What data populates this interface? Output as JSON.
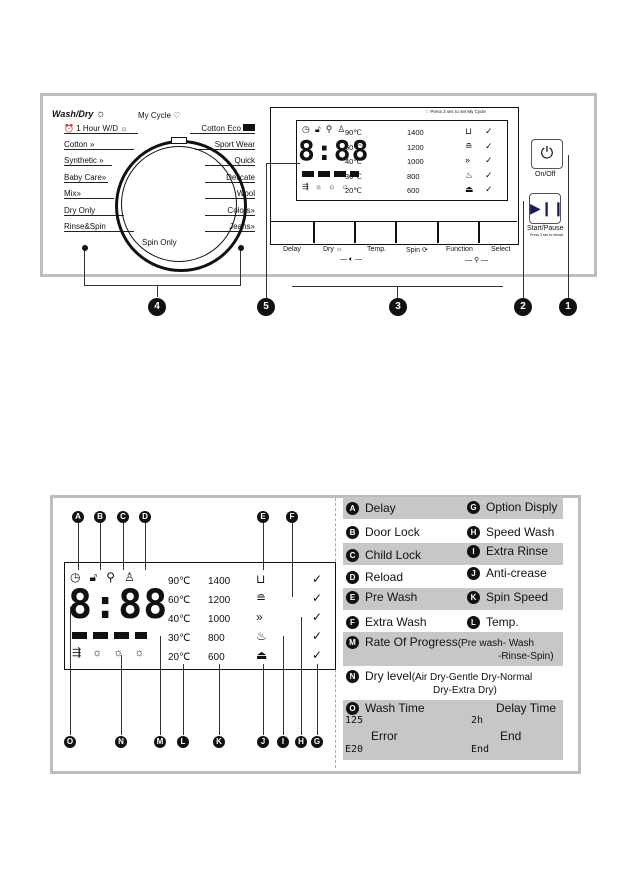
{
  "control_panel": {
    "brand": "Wash/Dry",
    "knob_top": "My Cycle",
    "knob_bottom": "Spin Only",
    "programs_left": [
      "1 Hour W/D",
      "Cotton",
      "Synthetic",
      "Baby Care",
      "Mix",
      "Dry Only",
      "Rinse&Spin"
    ],
    "programs_right": [
      "Cotton Eco",
      "Sport Wear",
      "Quick",
      "Delicate",
      "Wool",
      "Colors",
      "Jeans"
    ],
    "lcd_hint": "Press 3 sec to set My Cycle",
    "lcd_digits": "8:88",
    "temps": [
      "90℃",
      "60℃",
      "40℃",
      "30℃",
      "20℃"
    ],
    "speeds": [
      "1400",
      "1200",
      "1000",
      "800",
      "600"
    ],
    "checks": [
      "✓",
      "✓",
      "✓",
      "✓",
      "✓"
    ],
    "buttons": [
      "Delay",
      "Dry",
      "Temp.",
      "Spin",
      "Function",
      "Select"
    ],
    "onoff_label": "On/Off",
    "startpause_label": "Start/Pause",
    "startpause_hint": "Press 3 sec to reload",
    "callouts": [
      "1",
      "2",
      "3",
      "4",
      "5"
    ]
  },
  "display_diagram": {
    "letters_top": [
      "A",
      "B",
      "C",
      "D",
      "E",
      "F"
    ],
    "letters_bottom": [
      "O",
      "N",
      "M",
      "L",
      "K",
      "J",
      "I",
      "H",
      "G"
    ],
    "lcd_digits": "8:88",
    "temps": [
      "90℃",
      "60℃",
      "40℃",
      "30℃",
      "20℃"
    ],
    "speeds": [
      "1400",
      "1200",
      "1000",
      "800",
      "600"
    ],
    "checks": [
      "✓",
      "✓",
      "✓",
      "✓",
      "✓"
    ]
  },
  "legend": {
    "rows": [
      {
        "l_key": "A",
        "l_text": "Delay",
        "r_key": "G",
        "r_text": "Option Disply"
      },
      {
        "l_key": "B",
        "l_text": "Door Lock",
        "r_key": "H",
        "r_text": "Speed Wash"
      },
      {
        "l_key": "C",
        "l_text": "Child Lock",
        "r_key": "I",
        "r_text": "Extra Rinse"
      },
      {
        "l_key": "D",
        "l_text": "Reload",
        "r_key": "J",
        "r_text": "Anti-crease"
      },
      {
        "l_key": "E",
        "l_text": "Pre Wash",
        "r_key": "K",
        "r_text": "Spin Speed"
      },
      {
        "l_key": "F",
        "l_text": "Extra Wash",
        "r_key": "L",
        "r_text": "Temp."
      }
    ],
    "m": {
      "key": "M",
      "text": "Rate Of Progress",
      "detail1": "(Pre wash- Wash",
      "detail2": "-Rinse-Spin)"
    },
    "n": {
      "key": "N",
      "text": "Dry level",
      "detail1": "(Air Dry-Gentle Dry-Normal",
      "detail2": "Dry-Extra Dry)"
    },
    "o": {
      "key": "O",
      "wash_time": "Wash Time",
      "delay_time": "Delay Time",
      "wash_val": "125",
      "delay_val": "2h",
      "error": "Error",
      "end": "End",
      "error_val": "E20",
      "end_val": "End"
    }
  }
}
